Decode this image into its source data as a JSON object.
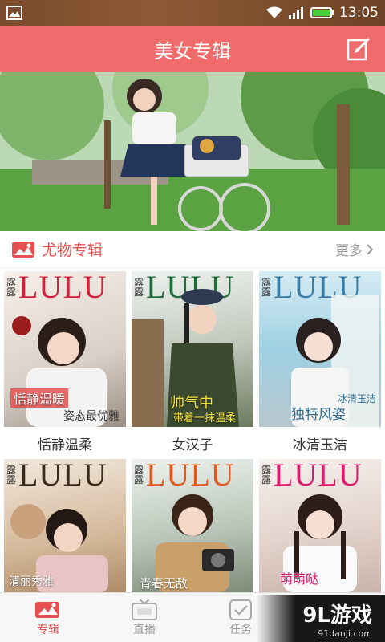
{
  "status": {
    "time": "13:05"
  },
  "header": {
    "title": "美女专辑"
  },
  "section": {
    "title": "尤物专辑",
    "more": "更多"
  },
  "albums": [
    {
      "cover_title": "LULU",
      "cover_mark": "露露",
      "badge": "恬静温暖",
      "badge2": "姿态最优雅",
      "caption": "恬静温柔",
      "title_color": "#d0213b"
    },
    {
      "cover_title": "LULU",
      "cover_mark": "露露",
      "badge": "帅气中",
      "badge2": "带着一抹温柔",
      "caption": "女汉子",
      "title_color": "#1f6b39"
    },
    {
      "cover_title": "LULU",
      "cover_mark": "露露",
      "badge": "独特风姿",
      "badge2": "冰清玉洁",
      "caption": "冰清玉洁",
      "title_color": "#3a7ea8"
    },
    {
      "cover_title": "LULU",
      "cover_mark": "露露",
      "badge": "清丽秀雅",
      "badge2": "",
      "caption": "",
      "title_color": "#3a2a1e"
    },
    {
      "cover_title": "LULU",
      "cover_mark": "露露",
      "badge": "青春无敌",
      "badge2": "",
      "caption": "",
      "title_color": "#e0581e"
    },
    {
      "cover_title": "LULU",
      "cover_mark": "露露",
      "badge": "萌萌哒",
      "badge2": "",
      "caption": "",
      "title_color": "#e0186e"
    }
  ],
  "tabs": [
    {
      "label": "专辑",
      "icon": "album-icon"
    },
    {
      "label": "直播",
      "icon": "tv-icon"
    },
    {
      "label": "任务",
      "icon": "task-icon"
    }
  ],
  "watermark": {
    "brand": "9L游戏",
    "url": "91danji.com"
  },
  "colors": {
    "accent": "#f06b6b",
    "accent_text": "#e65050"
  }
}
